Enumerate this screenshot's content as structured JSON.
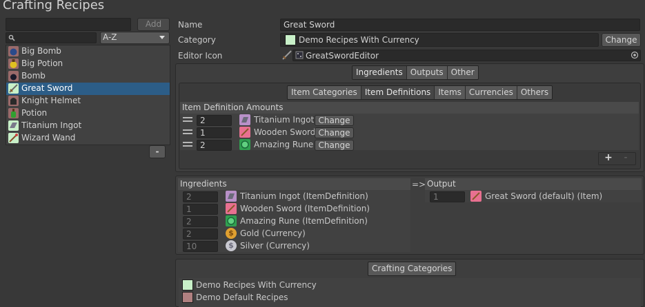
{
  "window": {
    "title": "Crafting Recipes"
  },
  "sidebar": {
    "new_name_value": "",
    "add_label": "Add",
    "search_value": "",
    "sort_value": "A-Z",
    "remove_label": "-",
    "items": [
      {
        "label": "Big Bomb"
      },
      {
        "label": "Big Potion"
      },
      {
        "label": "Bomb"
      },
      {
        "label": "Great Sword"
      },
      {
        "label": "Knight Helmet"
      },
      {
        "label": "Potion"
      },
      {
        "label": "Titanium Ingot"
      },
      {
        "label": "Wizard Wand"
      }
    ]
  },
  "form": {
    "name_label": "Name",
    "name_value": "Great Sword",
    "category_label": "Category",
    "category_value": "Demo Recipes With Currency",
    "category_color": "#c8f0c8",
    "change_label": "Change",
    "editor_icon_label": "Editor Icon",
    "editor_icon_value": "GreatSwordEditor"
  },
  "recipe_tabs": [
    {
      "label": "Ingredients",
      "active": true
    },
    {
      "label": "Outputs",
      "active": false
    },
    {
      "label": "Other",
      "active": false
    }
  ],
  "ingredient_tabs": [
    {
      "label": "Item Categories",
      "active": false
    },
    {
      "label": "Item Definitions",
      "active": true
    },
    {
      "label": "Items",
      "active": false
    },
    {
      "label": "Currencies",
      "active": false
    },
    {
      "label": "Others",
      "active": false
    }
  ],
  "amounts": {
    "header": "Item Definition Amounts",
    "change_label": "Change",
    "add_label": "+",
    "remove_label": "-",
    "rows": [
      {
        "amount": "2",
        "name": "Titanium Ingot"
      },
      {
        "amount": "1",
        "name": "Wooden Sword"
      },
      {
        "amount": "2",
        "name": "Amazing Rune"
      }
    ]
  },
  "summary": {
    "ingredients_header": "Ingredients",
    "arrow": "=>",
    "output_header": "Output",
    "ingredients": [
      {
        "amount": "2",
        "name": "Titanium Ingot (ItemDefinition)"
      },
      {
        "amount": "1",
        "name": "Wooden Sword (ItemDefinition)"
      },
      {
        "amount": "2",
        "name": "Amazing Rune (ItemDefinition)"
      },
      {
        "amount": "2",
        "name": "Gold (Currency)"
      },
      {
        "amount": "10",
        "name": "Silver (Currency)"
      }
    ],
    "outputs": [
      {
        "amount": "1",
        "name": "Great Sword (default) (Item)"
      }
    ]
  },
  "crafting_categories": {
    "header": "Crafting Categories",
    "items": [
      {
        "label": "Demo Recipes With Currency",
        "color": "#c8f0c8"
      },
      {
        "label": "Demo Default Recipes",
        "color": "#b08080"
      }
    ]
  }
}
